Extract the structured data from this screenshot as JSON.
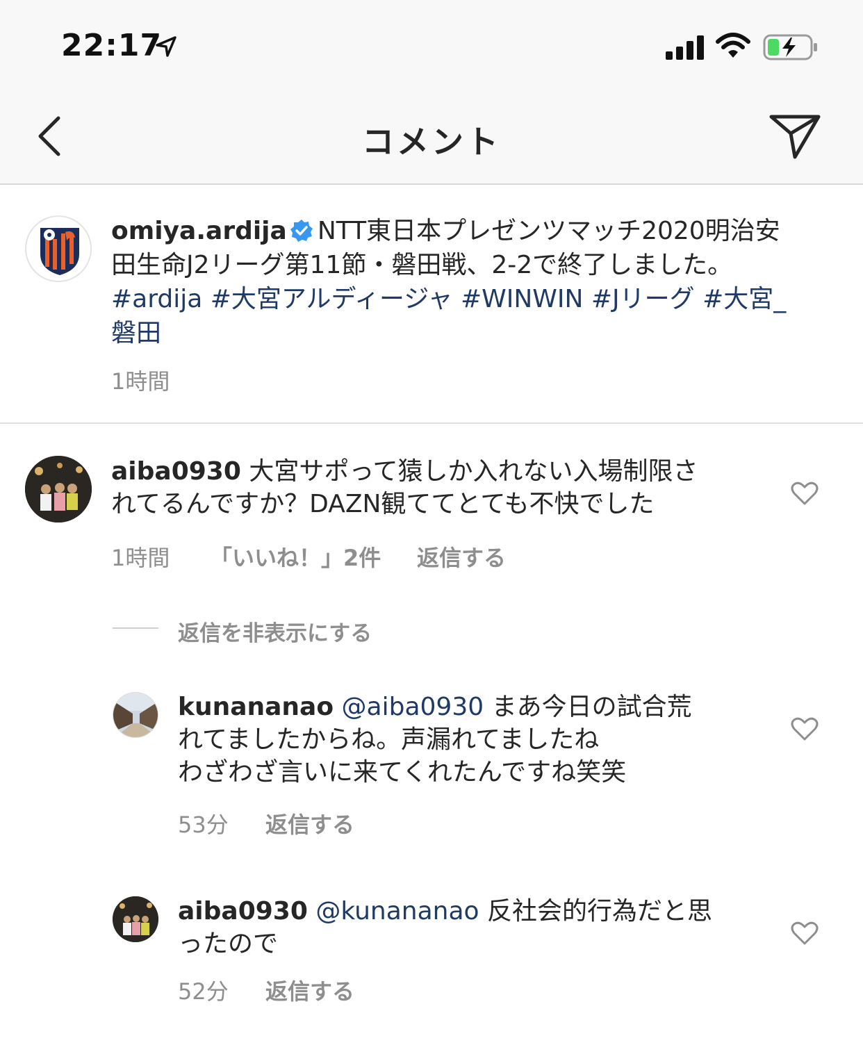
{
  "status_bar": {
    "time": "22:17",
    "icons": [
      "location-arrow-icon",
      "cellular-signal-icon",
      "wifi-icon",
      "battery-charging-icon"
    ],
    "battery_color": "#4cd964"
  },
  "nav": {
    "title": "コメント",
    "back_icon": "chevron-left-icon",
    "share_icon": "paper-plane-icon"
  },
  "caption": {
    "username": "omiya.ardija",
    "verified": true,
    "text_line1": "NTT東日本プレゼンツマッチ2020明治安",
    "text_line2": "田生命J2リーグ第11節・磐田戦、2-2で終了しました。",
    "hashtags_line1": "#ardija #大宮アルディージャ #WINWIN #Jリーグ #大宮_",
    "hashtags_line2": "磐田",
    "time": "1時間"
  },
  "comments": [
    {
      "username": "aiba0930",
      "text_line1": "大宮サポって猿しか入れない入場制限さ",
      "text_line2": "れてるんですか？DAZN観ててとても不快でした",
      "time": "1時間",
      "likes": "「いいね！」2件",
      "reply": "返信する"
    }
  ],
  "hide_replies": "返信を非表示にする",
  "replies": [
    {
      "username": "kunananao",
      "mention": "@aiba0930",
      "text_line1": "まあ今日の試合荒",
      "text_line2": "れてましたからね。声漏れてましたね",
      "text_line3": "わざわざ言いに来てくれたんですね笑笑",
      "time": "53分",
      "reply": "返信する"
    },
    {
      "username": "aiba0930",
      "mention": "@kunananao",
      "text_line1": "反社会的行為だと思",
      "text_line2": "ったので",
      "time": "52分",
      "reply": "返信する"
    }
  ],
  "colors": {
    "link": "#1f3a66",
    "secondary": "#8e8e8e",
    "verified": "#3897f0",
    "club_orange": "#e8612c",
    "club_navy": "#1b2d5a"
  }
}
